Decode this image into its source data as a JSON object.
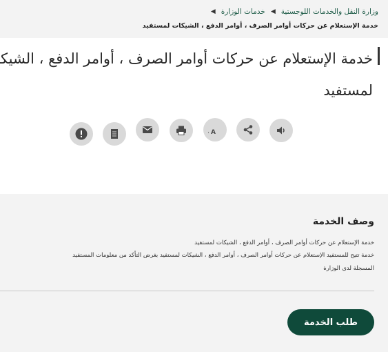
{
  "breadcrumb": {
    "items": [
      "وزارة النقل والخدمات اللوجستية",
      "خدمات الوزارة"
    ],
    "current": "خدمة الإستعلام عن حركات أوامر الصرف ، أوامر الدفع ، الشيكات لمستفيد"
  },
  "page": {
    "title": "خدمة الإستعلام عن حركات أوامر الصرف ، أوامر الدفع ، الشيكات لمستفيد"
  },
  "actions": [
    {
      "icon": "speaker-icon"
    },
    {
      "icon": "share-icon"
    },
    {
      "icon": "font-size-icon"
    },
    {
      "icon": "print-icon"
    },
    {
      "icon": "email-icon"
    },
    {
      "icon": "document-icon"
    },
    {
      "icon": "alert-icon"
    }
  ],
  "description": {
    "title": "وصف الخدمة",
    "lines": [
      "خدمة الإستعلام عن حركات أوامر الصرف ، أوامر الدفع ، الشيكات لمستفيد",
      "خدمة تتيح للمستفيد الإستعلام عن حركات أوامر الصرف ، أوامر الدفع ، الشيكات لمستفيد بغرض التأكد من معلومات المستفيد",
      "المسجلة لدى الوزارة"
    ]
  },
  "request_button": {
    "label": "طلب الخدمة"
  },
  "colors": {
    "brand": "#0f4a3a",
    "link": "#1d5b47",
    "icon_bg": "#d9d9d9",
    "icon_fg": "#4a4a4a"
  }
}
